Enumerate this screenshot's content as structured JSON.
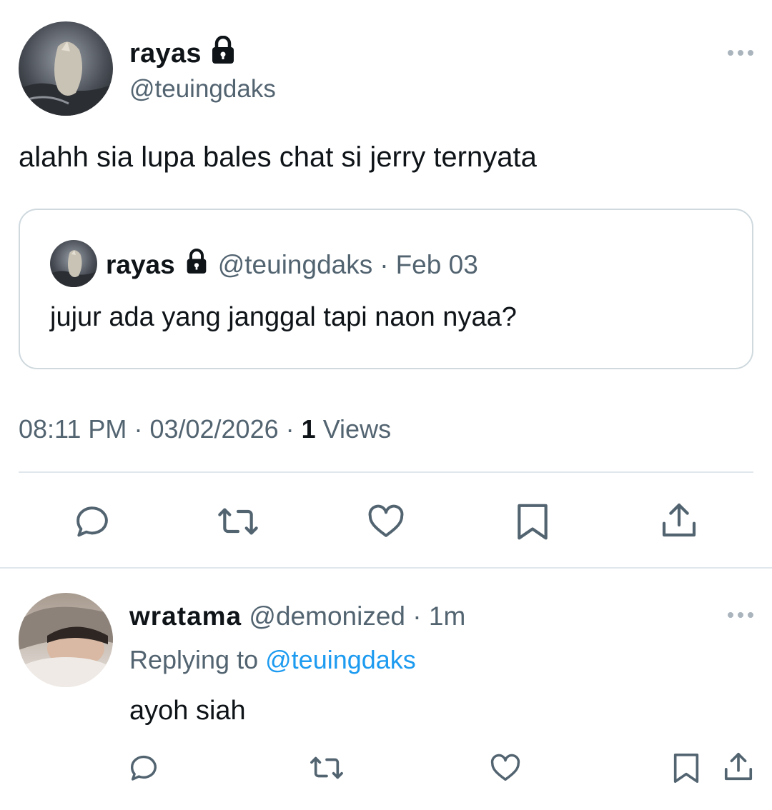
{
  "tweet": {
    "author_name": "rayas",
    "author_handle": "@teuingdaks",
    "text": "alahh sia lupa bales chat si jerry ternyata",
    "quoted": {
      "author_name": "rayas",
      "author_handle": "@teuingdaks",
      "separator": "·",
      "date": "Feb 03",
      "text": "jujur ada yang janggal tapi naon nyaa?"
    },
    "time": "08:11 PM",
    "date": "03/02/2026",
    "views_count": "1",
    "views_label": "Views"
  },
  "reply": {
    "author_name": "wratama",
    "author_handle": "@demonized",
    "separator": "·",
    "age": "1m",
    "replying_prefix": "Replying to",
    "replying_handle": "@teuingdaks",
    "text": "ayoh siah"
  },
  "icons": [
    "lock-icon",
    "more-icon",
    "reply-icon",
    "retweet-icon",
    "like-icon",
    "bookmark-icon",
    "share-icon"
  ],
  "colors": {
    "text": "#0f1419",
    "secondary": "#536471",
    "link": "#1d9bf0",
    "border": "#cfd9de"
  }
}
